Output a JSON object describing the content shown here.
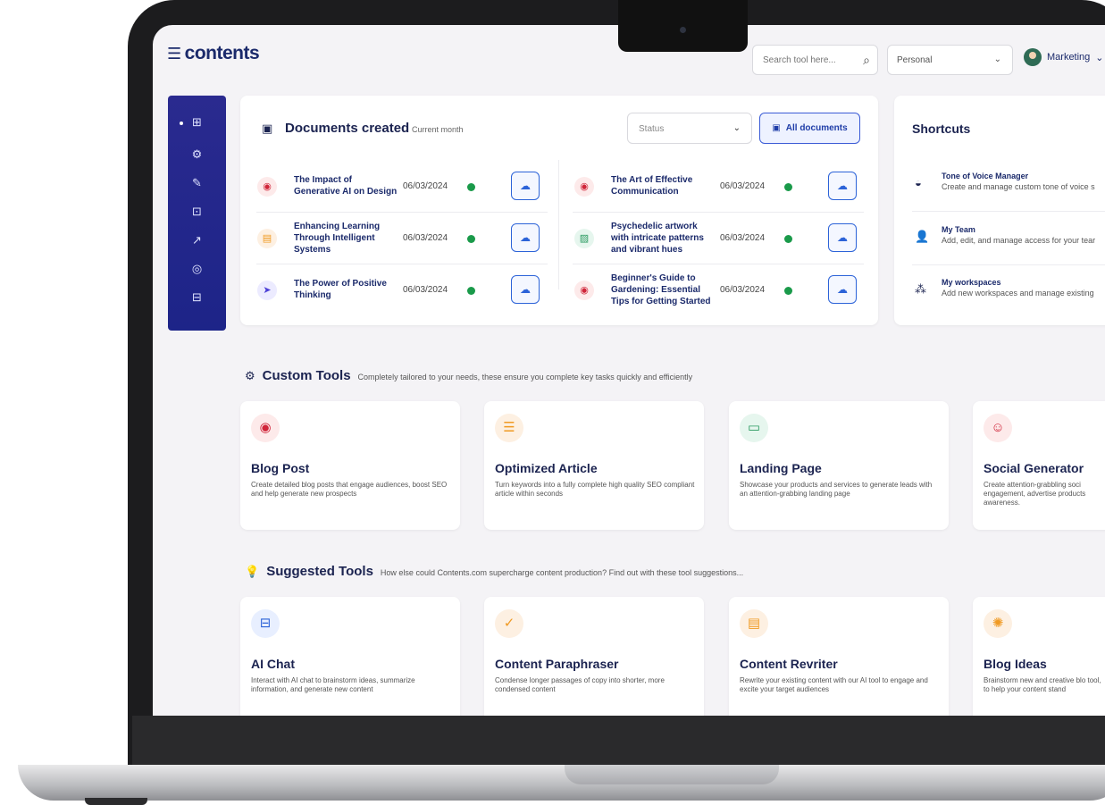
{
  "header": {
    "logo": "contents",
    "search_placeholder": "Search tool here...",
    "workspace_select": "Personal",
    "user_name": "Marketing"
  },
  "documents": {
    "title": "Documents created",
    "subtitle": "Current month",
    "status_placeholder": "Status",
    "all_button": "All documents",
    "left": [
      {
        "title": "The Impact of Generative AI on Design",
        "date": "06/03/2024",
        "icon": "chat-icon"
      },
      {
        "title": "Enhancing Learning Through Intelligent Systems",
        "date": "06/03/2024",
        "icon": "document-icon"
      },
      {
        "title": "The Power of Positive Thinking",
        "date": "06/03/2024",
        "icon": "send-icon"
      }
    ],
    "right": [
      {
        "title": "The Art of Effective Communication",
        "date": "06/03/2024",
        "icon": "chat-icon"
      },
      {
        "title": "Psychedelic artwork with intricate patterns and vibrant hues",
        "date": "06/03/2024",
        "icon": "image-icon"
      },
      {
        "title": "Beginner's Guide to Gardening: Essential Tips for Getting Started",
        "date": "06/03/2024",
        "icon": "chat-icon"
      }
    ]
  },
  "shortcuts": {
    "title": "Shortcuts",
    "items": [
      {
        "title": "Tone of Voice Manager",
        "desc": "Create and manage custom tone of voice s",
        "icon": "lips-icon"
      },
      {
        "title": "My Team",
        "desc": "Add, edit, and manage access for your tear",
        "icon": "add-user-icon"
      },
      {
        "title": "My workspaces",
        "desc": "Add new workspaces and manage existing",
        "icon": "workspaces-icon"
      }
    ]
  },
  "custom_tools": {
    "title": "Custom Tools",
    "subtitle": "Completely tailored to your needs, these ensure you complete key tasks quickly and efficiently",
    "items": [
      {
        "title": "Blog Post",
        "desc": "Create detailed blog posts that engage audiences, boost SEO and help generate new prospects",
        "icon": "chat-bubble-icon"
      },
      {
        "title": "Optimized Article",
        "desc": "Turn keywords into a fully complete high quality SEO compliant article within seconds",
        "icon": "checklist-icon"
      },
      {
        "title": "Landing Page",
        "desc": "Showcase your products and services to generate leads with an attention-grabbing landing page",
        "icon": "browser-icon"
      },
      {
        "title": "Social Generator",
        "desc": "Create attention-grabbling soci engagement, advertise products awareness.",
        "icon": "smile-chat-icon"
      }
    ]
  },
  "suggested_tools": {
    "title": "Suggested Tools",
    "subtitle": "How else could Contents.com supercharge content production? Find out with these tool suggestions...",
    "items": [
      {
        "title": "AI Chat",
        "desc": "Interact with AI chat to brainstorm ideas, summarize information, and generate new content",
        "icon": "robot-chat-icon"
      },
      {
        "title": "Content Paraphraser",
        "desc": "Condense longer passages of copy into shorter, more condensed content",
        "icon": "check-icon"
      },
      {
        "title": "Content Revriter",
        "desc": "Rewrite your existing content with our AI tool to engage and excite your target audiences",
        "icon": "file-icon"
      },
      {
        "title": "Blog Ideas",
        "desc": "Brainstorm new and creative blo tool, to help your content stand",
        "icon": "lightbulb-icon"
      }
    ]
  }
}
